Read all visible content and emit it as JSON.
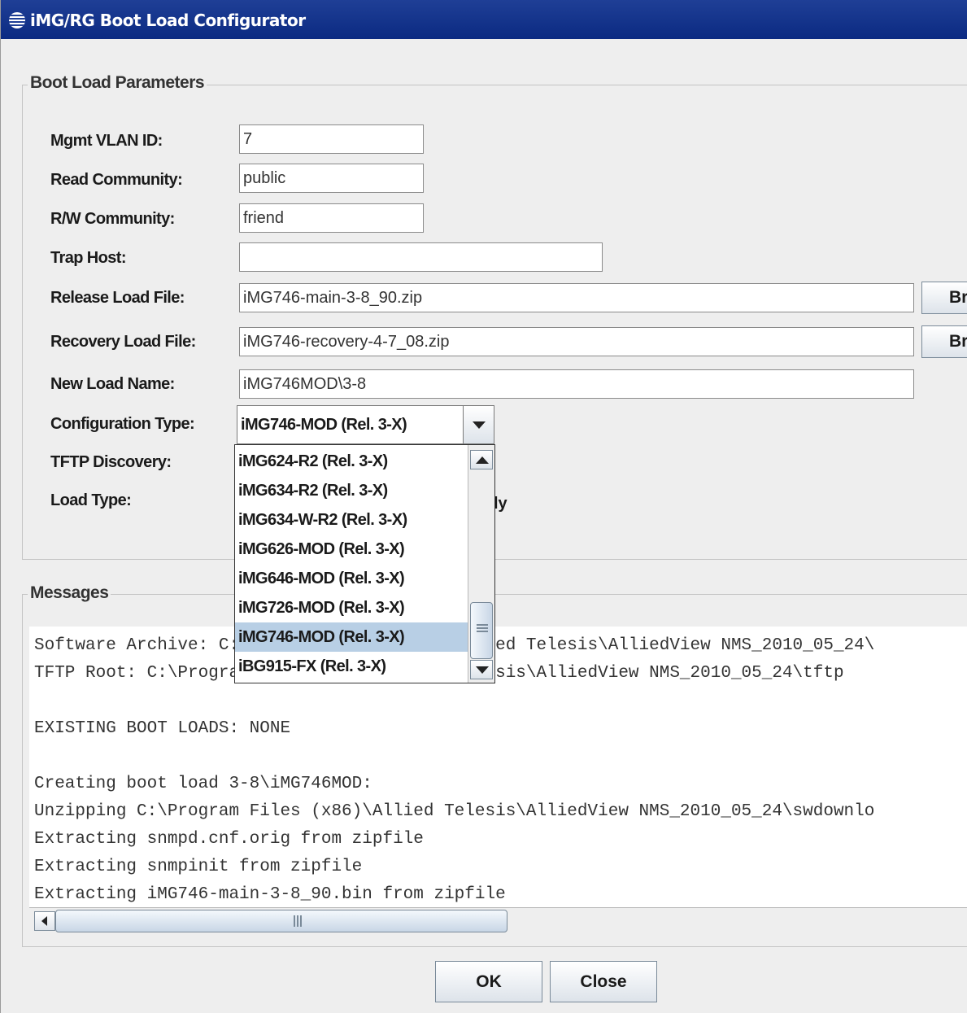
{
  "window": {
    "title": "iMG/RG Boot Load Configurator",
    "icon": "app-globe-icon"
  },
  "boot_params": {
    "group_title": "Boot Load Parameters",
    "mgmt_vlan_label": "Mgmt VLAN ID:",
    "mgmt_vlan_value": "7",
    "read_community_label": "Read Community:",
    "read_community_value": "public",
    "rw_community_label": "R/W Community:",
    "rw_community_value": "friend",
    "trap_host_label": "Trap Host:",
    "trap_host_value": "",
    "release_load_label": "Release Load File:",
    "release_load_value": "iMG746-main-3-8_90.zip",
    "release_browse_label": "Br",
    "recovery_load_label": "Recovery Load File:",
    "recovery_load_value": "iMG746-recovery-4-7_08.zip",
    "recovery_browse_label": "Br",
    "new_load_label": "New Load Name:",
    "new_load_value": "iMG746MOD\\3-8",
    "config_type_label": "Configuration Type:",
    "config_type_value": "iMG746-MOD (Rel. 3-X)",
    "tftp_discovery_label": "TFTP Discovery:",
    "load_type_label": "Load Type:",
    "load_type_partial": "ly"
  },
  "dropdown": {
    "options": [
      "iMG624-R2 (Rel. 3-X)",
      "iMG634-R2 (Rel. 3-X)",
      "iMG634-W-R2 (Rel. 3-X)",
      "iMG626-MOD (Rel. 3-X)",
      "iMG646-MOD (Rel. 3-X)",
      "iMG726-MOD (Rel. 3-X)",
      "iMG746-MOD (Rel. 3-X)",
      "iBG915-FX (Rel. 3-X)"
    ],
    "selected": "iMG746-MOD (Rel. 3-X)"
  },
  "messages": {
    "group_title": "Messages",
    "lines": [
      "Software Archive: C:\\Program Files (x86)\\Allied Telesis\\AlliedView NMS_2010_05_24\\",
      "TFTP Root: C:\\Program Files (x86)\\Allied Telesis\\AlliedView NMS_2010_05_24\\tftp",
      "",
      "EXISTING BOOT LOADS: NONE",
      "",
      "Creating boot load 3-8\\iMG746MOD:",
      "Unzipping C:\\Program Files (x86)\\Allied Telesis\\AlliedView NMS_2010_05_24\\swdownlo",
      "Extracting snmpd.cnf.orig from zipfile",
      "Extracting snmpinit from zipfile",
      "Extracting iMG746-main-3-8_90.bin from zipfile"
    ]
  },
  "buttons": {
    "ok": "OK",
    "close": "Close"
  }
}
